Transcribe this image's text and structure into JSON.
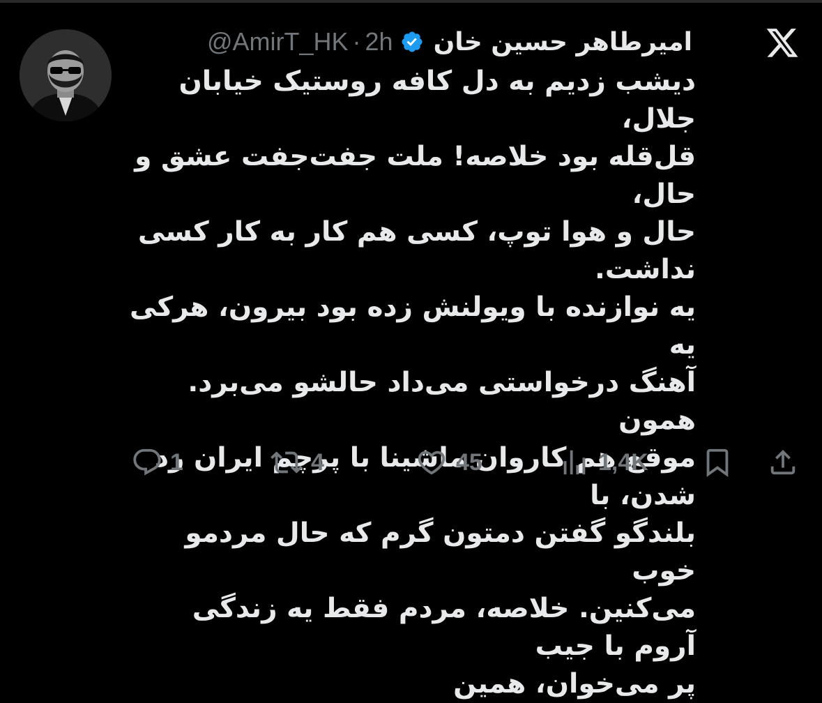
{
  "author": {
    "display_name": "امیرطاهر حسین خان",
    "handle": "@AmirT_HK",
    "separator": "·",
    "time": "2h",
    "verified": true,
    "avatar_icon": "profile-photo"
  },
  "platform_icon": "x-logo-icon",
  "tweet": {
    "text": "دیشب زدیم به دل کافه روستیک  خیابان جلال،\nقل‌قله بود خلاصه! ملت جفت‌جفت عشق و حال،\nحال و هوا توپ، کسی هم کار به کار کسی نداشت.\nیه نوازنده با ویولنش زده بود بیرون، هرکی یه\nآهنگ درخواستی می‌داد حالشو می‌برد. همون\nموقع هم کاروان ماشینا با پرچم ایران رد شدن، با\nبلندگو گفتن دمتون گرم که حال مردمو خوب\nمی‌کنین. خلاصه، مردم فقط یه زندگی آروم با جیب\nپر می‌خوان، همین"
  },
  "actions": {
    "reply_count": "1",
    "repost_count": "4",
    "like_count": "45",
    "views_count": "1,4K"
  },
  "colors": {
    "background": "#000000",
    "text_primary": "#e7e9ea",
    "text_secondary": "#71767b",
    "verified_blue": "#1d9bf0"
  }
}
